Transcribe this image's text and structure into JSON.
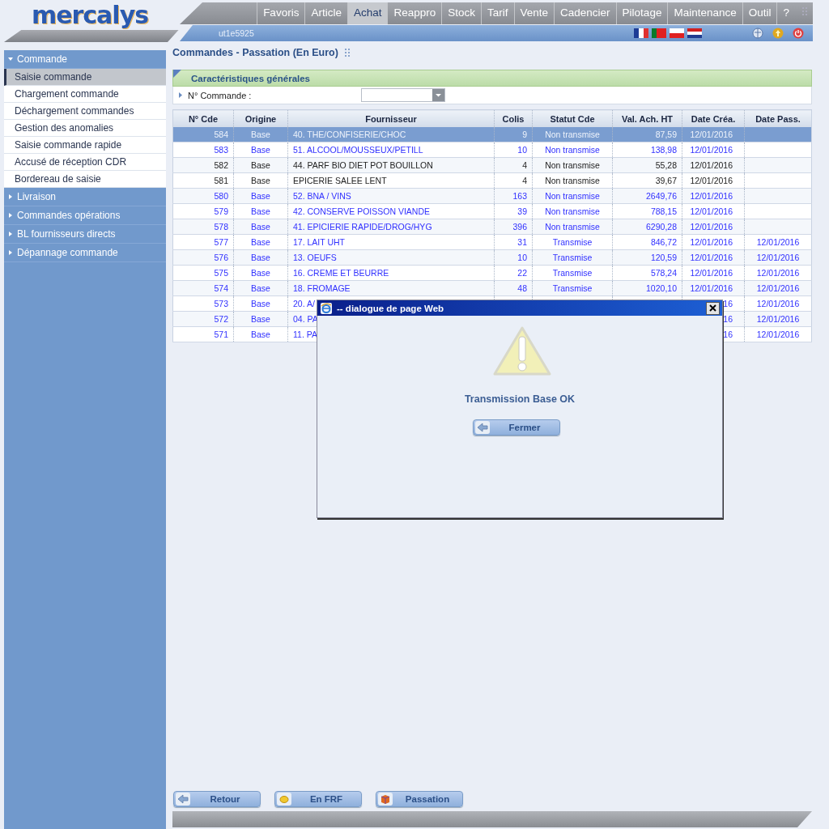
{
  "logo": {
    "text": "mercalys"
  },
  "nav": {
    "tabs": [
      {
        "label": "Favoris",
        "selected": false
      },
      {
        "label": "Article",
        "selected": false
      },
      {
        "label": "Achat",
        "selected": true
      },
      {
        "label": "Reappro",
        "selected": false
      },
      {
        "label": "Stock",
        "selected": false
      },
      {
        "label": "Tarif",
        "selected": false
      },
      {
        "label": "Vente",
        "selected": false
      },
      {
        "label": "Cadencier",
        "selected": false
      },
      {
        "label": "Pilotage",
        "selected": false
      },
      {
        "label": "Maintenance",
        "selected": false
      },
      {
        "label": "Outil",
        "selected": false
      },
      {
        "label": "?",
        "selected": false
      }
    ],
    "user": "ut1e5925"
  },
  "sidebar": {
    "sections": [
      {
        "label": "Commande",
        "expanded": true,
        "items": [
          {
            "label": "Saisie commande",
            "selected": true
          },
          {
            "label": "Chargement commande",
            "selected": false
          },
          {
            "label": "Déchargement commandes",
            "selected": false
          },
          {
            "label": "Gestion des anomalies",
            "selected": false
          },
          {
            "label": "Saisie commande rapide",
            "selected": false
          },
          {
            "label": "Accusé de réception CDR",
            "selected": false
          },
          {
            "label": "Bordereau de saisie",
            "selected": false
          }
        ]
      },
      {
        "label": "Livraison",
        "expanded": false
      },
      {
        "label": "Commandes opérations",
        "expanded": false
      },
      {
        "label": "BL fournisseurs directs",
        "expanded": false
      },
      {
        "label": "Dépannage commande",
        "expanded": false
      }
    ]
  },
  "page_title": "Commandes - Passation (En Euro)",
  "section": {
    "title": "Caractéristiques générales",
    "field_label": "N° Commande :"
  },
  "table": {
    "columns": [
      "N° Cde",
      "Origine",
      "Fournisseur",
      "Colis",
      "Statut Cde",
      "Val. Ach. HT",
      "Date Créa.",
      "Date Pass."
    ],
    "rows": [
      {
        "n": "584",
        "origine": "Base",
        "fournisseur": "40. THE/CONFISERIE/CHOC",
        "colis": "9",
        "statut": "Non transmise",
        "val": "87,59",
        "date_crea": "12/01/2016",
        "selected": true,
        "kind": "link"
      },
      {
        "n": "583",
        "origine": "Base",
        "fournisseur": "51. ALCOOL/MOUSSEUX/PETILL",
        "colis": "10",
        "statut": "Non transmise",
        "val": "138,98",
        "date_crea": "12/01/2016",
        "selected": false,
        "kind": "link"
      },
      {
        "n": "582",
        "origine": "Base",
        "fournisseur": "44. PARF BIO DIET POT BOUILLON",
        "colis": "4",
        "statut": "Non transmise",
        "val": "55,28",
        "date_crea": "12/01/2016",
        "selected": false,
        "kind": "plain"
      },
      {
        "n": "581",
        "origine": "Base",
        "fournisseur": "EPICERIE SALEE LENT",
        "colis": "4",
        "statut": "Non transmise",
        "val": "39,67",
        "date_crea": "12/01/2016",
        "selected": false,
        "kind": "plain"
      },
      {
        "n": "580",
        "origine": "Base",
        "fournisseur": "52. BNA / VINS",
        "colis": "163",
        "statut": "Non transmise",
        "val": "2649,76",
        "date_crea": "12/01/2016",
        "selected": false,
        "kind": "link"
      },
      {
        "n": "579",
        "origine": "Base",
        "fournisseur": "42. CONSERVE POISSON VIANDE",
        "colis": "39",
        "statut": "Non transmise",
        "val": "788,15",
        "date_crea": "12/01/2016",
        "selected": false,
        "kind": "link"
      },
      {
        "n": "578",
        "origine": "Base",
        "fournisseur": "41. EPICIERIE RAPIDE/DROG/HYG",
        "colis": "396",
        "statut": "Non transmise",
        "val": "6290,28",
        "date_crea": "12/01/2016",
        "selected": false,
        "kind": "link"
      },
      {
        "n": "577",
        "origine": "Base",
        "fournisseur": "17. LAIT UHT",
        "colis": "31",
        "statut": "Transmise",
        "val": "846,72",
        "date_crea": "12/01/2016",
        "date_pass": "12/01/2016",
        "selected": false,
        "kind": "link"
      },
      {
        "n": "576",
        "origine": "Base",
        "fournisseur": "13. OEUFS",
        "colis": "10",
        "statut": "Transmise",
        "val": "120,59",
        "date_crea": "12/01/2016",
        "date_pass": "12/01/2016",
        "selected": false,
        "kind": "link"
      },
      {
        "n": "575",
        "origine": "Base",
        "fournisseur": "16. CREME ET BEURRE",
        "colis": "22",
        "statut": "Transmise",
        "val": "578,24",
        "date_crea": "12/01/2016",
        "date_pass": "12/01/2016",
        "selected": false,
        "kind": "link"
      },
      {
        "n": "574",
        "origine": "Base",
        "fournisseur": "18. FROMAGE",
        "colis": "48",
        "statut": "Transmise",
        "val": "1020,10",
        "date_crea": "12/01/2016",
        "date_pass": "12/01/2016",
        "selected": false,
        "kind": "link"
      },
      {
        "n": "573",
        "origine": "Base",
        "fournisseur": "20. A/",
        "date_crea": "16",
        "date_pass": "12/01/2016",
        "selected": false,
        "kind": "link"
      },
      {
        "n": "572",
        "origine": "Base",
        "fournisseur": "04. PA",
        "date_crea": "16",
        "date_pass": "12/01/2016",
        "selected": false,
        "kind": "link"
      },
      {
        "n": "571",
        "origine": "Base",
        "fournisseur": "11. PA",
        "date_crea": "16",
        "date_pass": "12/01/2016",
        "selected": false,
        "kind": "link"
      }
    ]
  },
  "dialog": {
    "title": "-- dialogue de page Web",
    "message": "Transmission Base OK",
    "button": "Fermer"
  },
  "buttons": [
    {
      "label": "Retour",
      "kind": "back"
    },
    {
      "label": "En FRF",
      "kind": "coin"
    },
    {
      "label": "Passation",
      "kind": "box"
    }
  ]
}
